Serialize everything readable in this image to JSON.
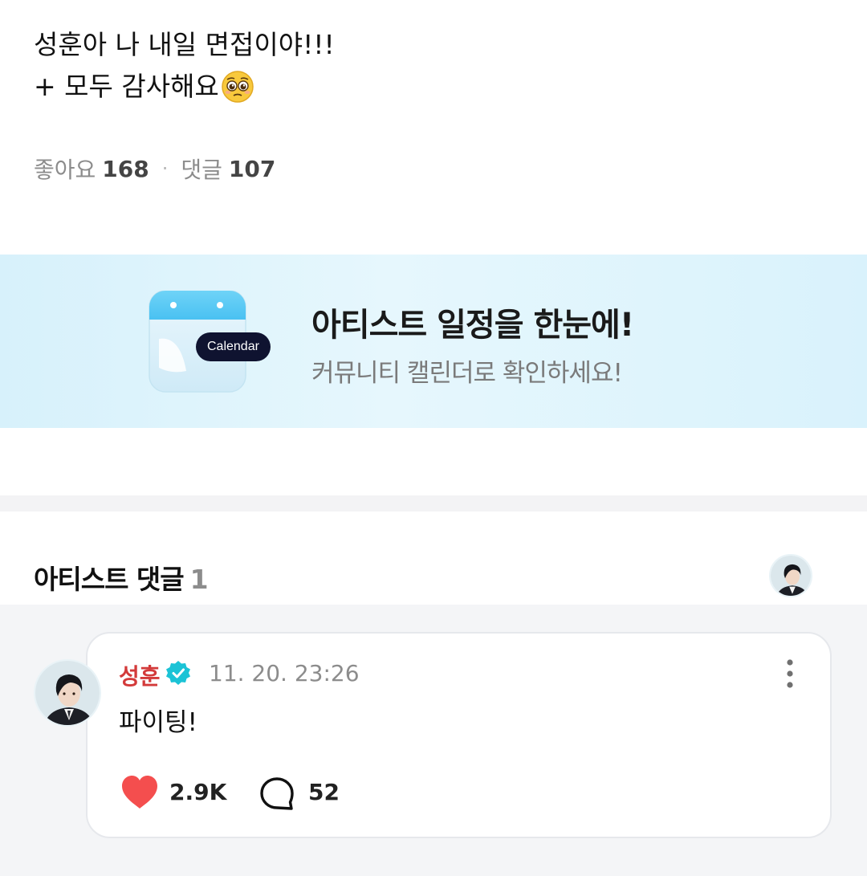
{
  "post": {
    "line1": "성훈아 나 내일 면접이야!!!",
    "line2": "+ 모두 감사해요",
    "emoji": "pleading-face-emoji"
  },
  "stats": {
    "likes_label": "좋아요",
    "likes_value": "168",
    "separator": "·",
    "comments_label": "댓글",
    "comments_value": "107"
  },
  "banner": {
    "badge": "Calendar",
    "title": "아티스트 일정을 한눈에!",
    "subtitle": "커뮤니티 캘린더로 확인하세요!"
  },
  "artist_comments": {
    "title": "아티스트 댓글",
    "count": "1",
    "comment": {
      "author": "성훈",
      "verified": true,
      "timestamp": "11. 20. 23:26",
      "text": "파이팅!",
      "likes": "2.9K",
      "replies": "52"
    }
  },
  "colors": {
    "author_red": "#d33a3a",
    "verified_teal": "#1bc3d6",
    "like_red": "#f44e4e",
    "banner_bg": "#dff3fc"
  }
}
